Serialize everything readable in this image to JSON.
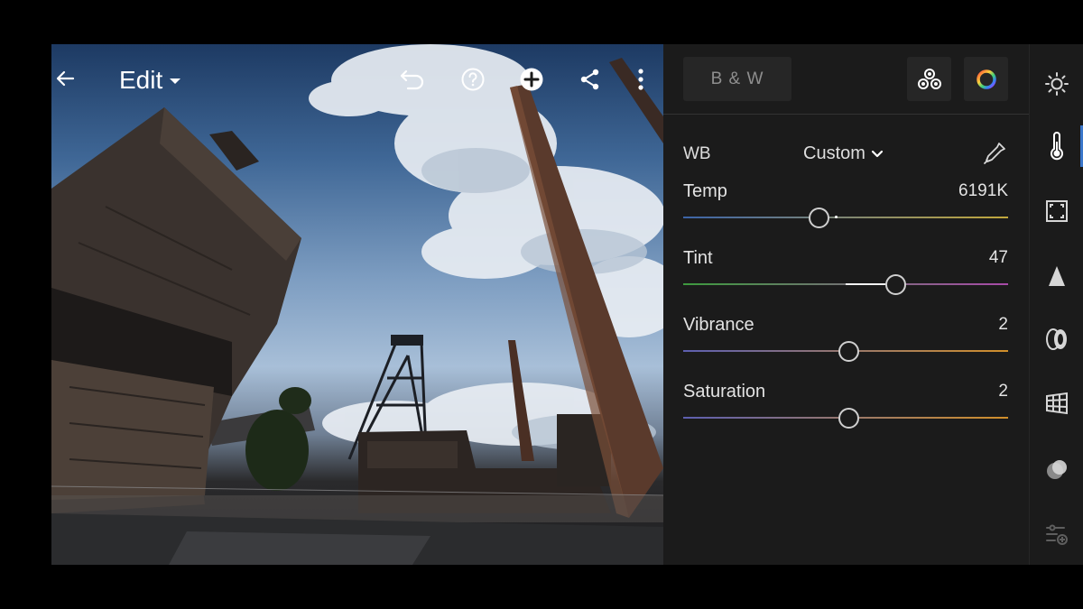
{
  "header": {
    "title": "Edit",
    "icons": [
      "back-arrow-icon",
      "undo-icon",
      "help-icon",
      "add-icon",
      "share-icon",
      "more-vertical-icon"
    ]
  },
  "panel": {
    "bw_label": "B & W",
    "icons": [
      "presets-icon",
      "color-mix-icon"
    ],
    "wb": {
      "label": "WB",
      "value": "Custom"
    },
    "sliders": [
      {
        "label": "Temp",
        "value": "6191K",
        "fraction": 0.417,
        "gradient": [
          "#3c64a8",
          "#c2a83c"
        ]
      },
      {
        "label": "Tint",
        "value": "47",
        "fraction": 0.655,
        "gradient": [
          "#3d9a3e",
          "#a84aa8"
        ]
      },
      {
        "label": "Vibrance",
        "value": "2",
        "fraction": 0.51,
        "gradient": [
          "#5d5fb0",
          "#d18f2a"
        ]
      },
      {
        "label": "Saturation",
        "value": "2",
        "fraction": 0.51,
        "gradient": [
          "#5d5fb0",
          "#d18f2a"
        ]
      }
    ]
  },
  "rail": {
    "icons": [
      "light-icon",
      "color-temperature-icon",
      "crop-icon",
      "effects-icon",
      "lens-icon",
      "geometry-icon",
      "detail-icon",
      "adjust-more-icon"
    ],
    "active_index": 1
  },
  "colors": {
    "accent": "#3a76c9",
    "panel_bg": "#1b1b1b",
    "button_bg": "#262626"
  }
}
